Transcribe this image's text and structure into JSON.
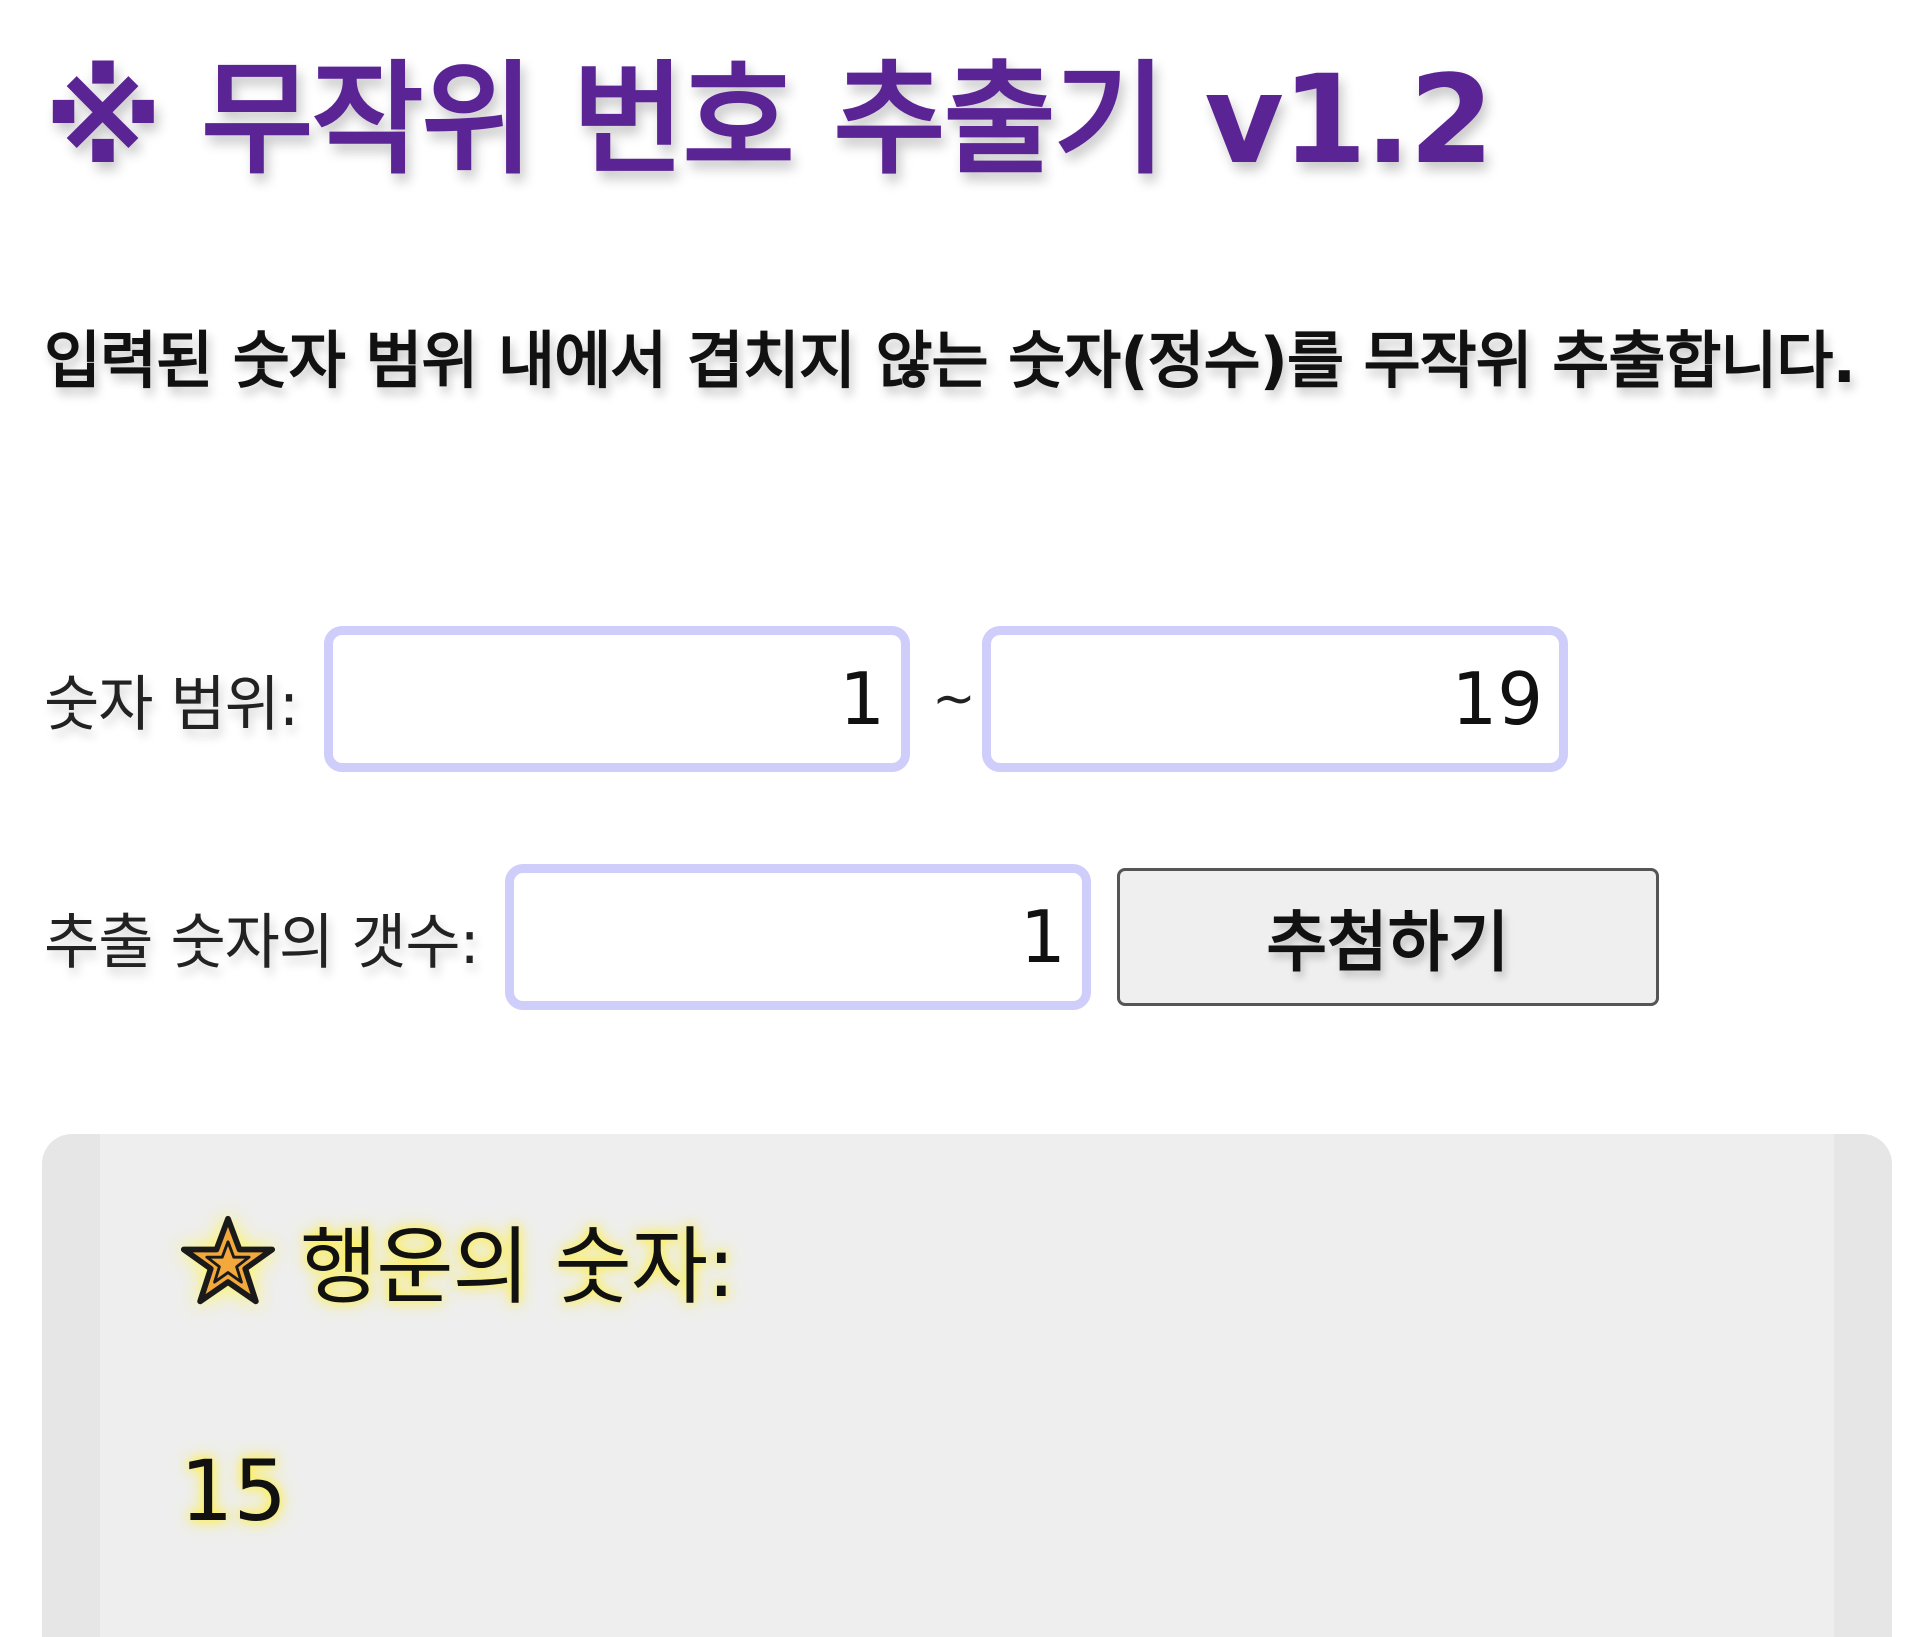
{
  "title": "※ 무작위 번호 추출기 v1.2",
  "description": "입력된 숫자 범위 내에서 겹치지 않는 숫자(정수)를 무작위 추출합니다.",
  "range": {
    "label": "숫자 범위:",
    "min_value": "1",
    "separator": "~",
    "max_value": "19"
  },
  "count": {
    "label": "추출 숫자의 갯수:",
    "value": "1"
  },
  "draw_button": {
    "label": "추첨하기"
  },
  "result": {
    "icon": "star-icon",
    "label": "행운의 숫자:",
    "value": "15"
  },
  "colors": {
    "title": "#5b2494",
    "input_border": "#cfcdfa",
    "result_background": "#eeeeee",
    "glow": "#fff03c"
  }
}
